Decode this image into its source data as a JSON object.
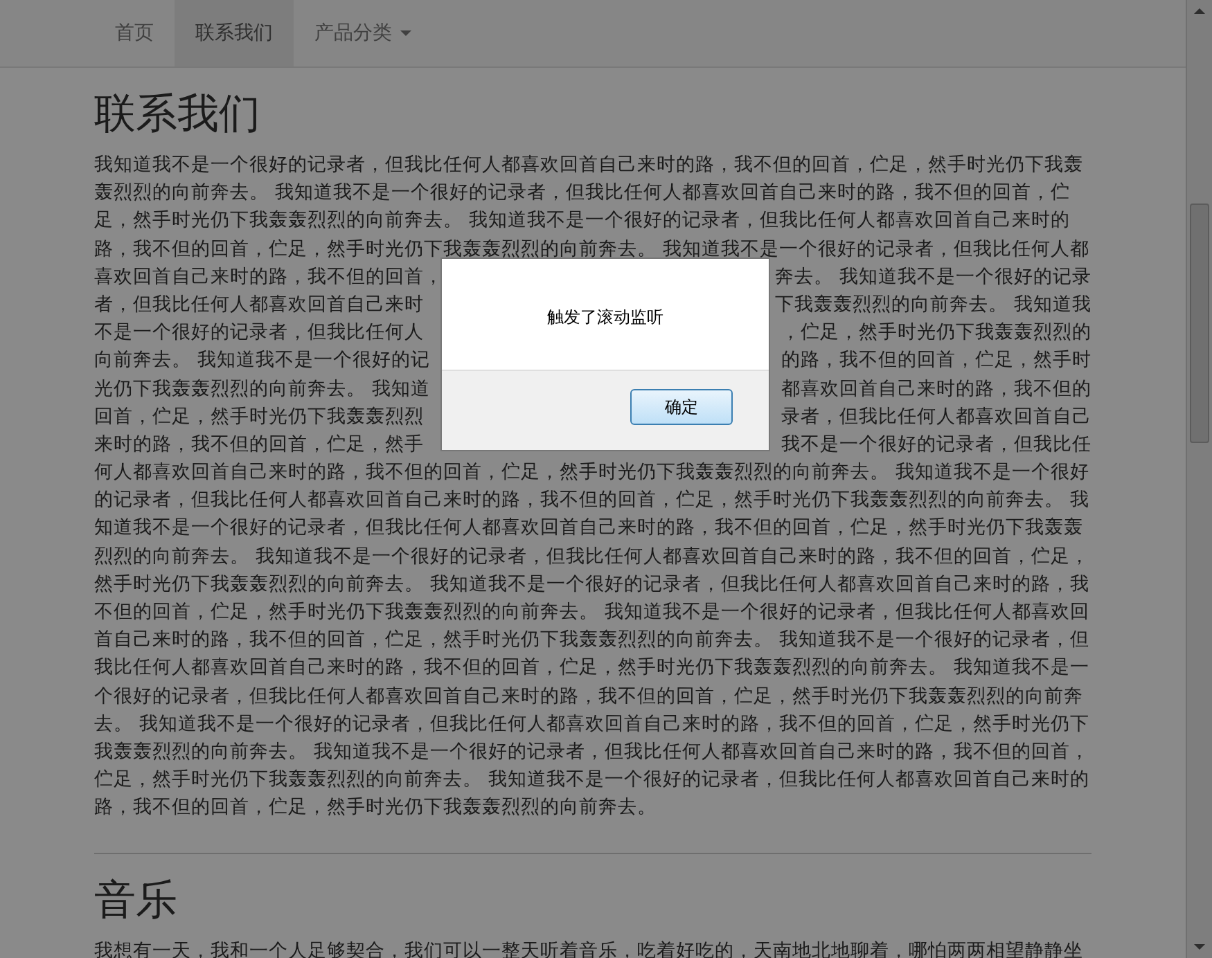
{
  "nav": {
    "items": [
      {
        "label": "首页",
        "selected": false,
        "dropdown": false
      },
      {
        "label": "联系我们",
        "selected": true,
        "dropdown": false
      },
      {
        "label": "产品分类",
        "selected": false,
        "dropdown": true
      }
    ]
  },
  "sections": [
    {
      "heading": "联系我们",
      "lines": [
        [
          "我知道我不是一个很好的记录者，但我比任何人都喜欢回首自己来时的路，我不但的回首，伫足，然手时光仍下我轰"
        ],
        [
          "轰烈烈的向前奔去。 我知道我不是一个很好的记录者，但我比任何人都喜欢回首自己来时的路，我不但的回首，伫"
        ],
        [
          "足，然手时光仍下我轰轰烈烈的向前奔去。 我知道我不是一个很好的记录者，但我比任何人都喜欢回首自己来时的"
        ],
        [
          "路，我不但的回首，伫足，然手时光仍下我轰轰烈烈的向前奔去。 我知道我不是一个很好的记录者，但我比任何人都"
        ],
        [
          "喜欢回首自己来时的路，我不但的回首，",
          "奔去。 我知道我不是一个很好的记录"
        ],
        [
          "者，但我比任何人都喜欢回首自己来时",
          "下我轰轰烈烈的向前奔去。 我知道我"
        ],
        [
          "不是一个很好的记录者，但我比任何人",
          "，伫足，然手时光仍下我轰轰烈烈的"
        ],
        [
          "向前奔去。 我知道我不是一个很好的记",
          "的路，我不但的回首，伫足，然手时"
        ],
        [
          "光仍下我轰轰烈烈的向前奔去。 我知道",
          "都喜欢回首自己来时的路，我不但的"
        ],
        [
          "回首，伫足，然手时光仍下我轰轰烈烈",
          "录者，但我比任何人都喜欢回首自己"
        ],
        [
          "来时的路，我不但的回首，伫足，然手",
          "我不是一个很好的记录者，但我比任"
        ],
        [
          "何人都喜欢回首自己来时的路，我不但的回首，伫足，然手时光仍下我轰轰烈烈的向前奔去。 我知道我不是一个很好"
        ],
        [
          "的记录者，但我比任何人都喜欢回首自己来时的路，我不但的回首，伫足，然手时光仍下我轰轰烈烈的向前奔去。 我"
        ],
        [
          "知道我不是一个很好的记录者，但我比任何人都喜欢回首自己来时的路，我不但的回首，伫足，然手时光仍下我轰轰"
        ],
        [
          "烈烈的向前奔去。 我知道我不是一个很好的记录者，但我比任何人都喜欢回首自己来时的路，我不但的回首，伫足，"
        ],
        [
          "然手时光仍下我轰轰烈烈的向前奔去。 我知道我不是一个很好的记录者，但我比任何人都喜欢回首自己来时的路，我"
        ],
        [
          "不但的回首，伫足，然手时光仍下我轰轰烈烈的向前奔去。 我知道我不是一个很好的记录者，但我比任何人都喜欢回"
        ],
        [
          "首自己来时的路，我不但的回首，伫足，然手时光仍下我轰轰烈烈的向前奔去。 我知道我不是一个很好的记录者，但"
        ],
        [
          "我比任何人都喜欢回首自己来时的路，我不但的回首，伫足，然手时光仍下我轰轰烈烈的向前奔去。 我知道我不是一"
        ],
        [
          "个很好的记录者，但我比任何人都喜欢回首自己来时的路，我不但的回首，伫足，然手时光仍下我轰轰烈烈的向前奔"
        ],
        [
          "去。 我知道我不是一个很好的记录者，但我比任何人都喜欢回首自己来时的路，我不但的回首，伫足，然手时光仍下"
        ],
        [
          "我轰轰烈烈的向前奔去。 我知道我不是一个很好的记录者，但我比任何人都喜欢回首自己来时的路，我不但的回首，"
        ],
        [
          "伫足，然手时光仍下我轰轰烈烈的向前奔去。 我知道我不是一个很好的记录者，但我比任何人都喜欢回首自己来时的"
        ],
        [
          "路，我不但的回首，伫足，然手时光仍下我轰轰烈烈的向前奔去。"
        ]
      ]
    },
    {
      "heading": "音乐",
      "lines": [
        [
          "我想有一天，我和一个人足够契合，我们可以一整天听着音乐，吃着好吃的，天南地北地聊着，哪怕两两相望静静坐"
        ]
      ]
    }
  ],
  "dialog": {
    "message": "触发了滚动监听",
    "button": "确定"
  }
}
